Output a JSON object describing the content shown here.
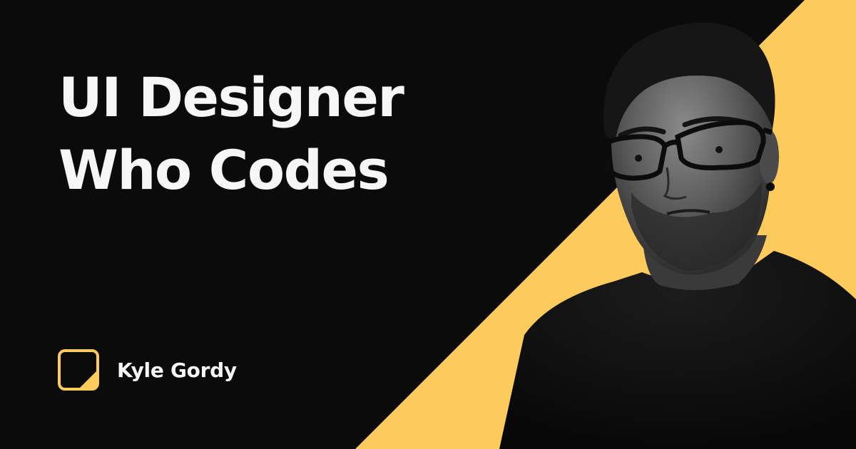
{
  "headline": {
    "line1": "UI Designer",
    "line2": "Who Codes"
  },
  "author": {
    "name": "Kyle Gordy"
  },
  "logo": {
    "icon": "folded-corner-square-icon"
  },
  "portrait": {
    "icon": "person-portrait-photo",
    "style": "black-and-white"
  },
  "colors": {
    "background": "#0b0b0b",
    "accent": "#fdca5c",
    "text": "#f6f6f6"
  }
}
